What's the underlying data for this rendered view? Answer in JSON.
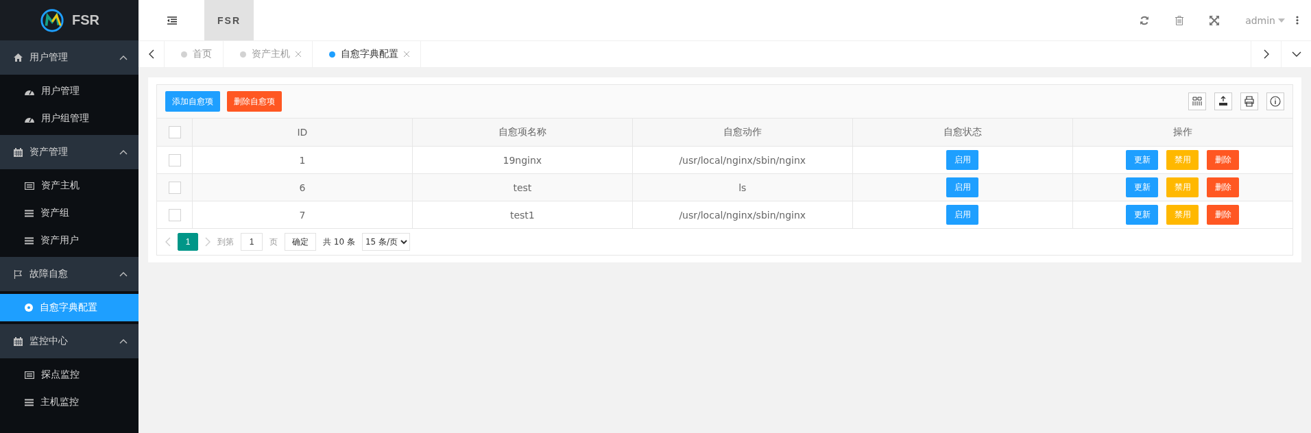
{
  "logo": {
    "text": "FSR"
  },
  "topbar": {
    "title": "FSR",
    "user": "admin"
  },
  "sidebar": {
    "groups": [
      {
        "label": "用户管理",
        "expanded": true,
        "children": [
          {
            "label": "用户管理",
            "selected": false
          },
          {
            "label": "用户组管理",
            "selected": false
          }
        ]
      },
      {
        "label": "资产管理",
        "expanded": true,
        "children": [
          {
            "label": "资产主机",
            "selected": false
          },
          {
            "label": "资产组",
            "selected": false
          },
          {
            "label": "资产用户",
            "selected": false
          }
        ]
      },
      {
        "label": "故障自愈",
        "expanded": true,
        "children": [
          {
            "label": "自愈字典配置",
            "selected": true
          }
        ]
      },
      {
        "label": "监控中心",
        "expanded": true,
        "children": [
          {
            "label": "探点监控",
            "selected": false
          },
          {
            "label": "主机监控",
            "selected": false
          }
        ]
      }
    ]
  },
  "tabs": [
    {
      "label": "首页",
      "closable": false,
      "selected": false
    },
    {
      "label": "资产主机",
      "closable": true,
      "selected": false
    },
    {
      "label": "自愈字典配置",
      "closable": true,
      "selected": true
    }
  ],
  "toolbar": {
    "buttons": [
      {
        "label": "添加自愈项",
        "kind": "primary"
      },
      {
        "label": "删除自愈项",
        "kind": "danger"
      }
    ]
  },
  "table": {
    "select_all_checked": false,
    "columns": [
      "ID",
      "自愈项名称",
      "自愈动作",
      "自愈状态",
      "操作"
    ],
    "rows": [
      {
        "checked": false,
        "id": "1",
        "name": "19nginx",
        "action": "/usr/local/nginx/sbin/nginx",
        "status": "启用",
        "ops": [
          "更新",
          "禁用",
          "删除"
        ]
      },
      {
        "checked": false,
        "id": "6",
        "name": "test",
        "action": "ls",
        "status": "启用",
        "ops": [
          "更新",
          "禁用",
          "删除"
        ]
      },
      {
        "checked": false,
        "id": "7",
        "name": "test1",
        "action": "/usr/local/nginx/sbin/nginx",
        "status": "启用",
        "ops": [
          "更新",
          "禁用",
          "删除"
        ]
      }
    ]
  },
  "pagination": {
    "pages": [
      {
        "label": "1",
        "selected": true
      }
    ],
    "goto_label": "到第",
    "goto_value": "1",
    "page_unit": "页",
    "confirm": "确定",
    "total": "共 10 条",
    "page_size": "15 条/页"
  }
}
